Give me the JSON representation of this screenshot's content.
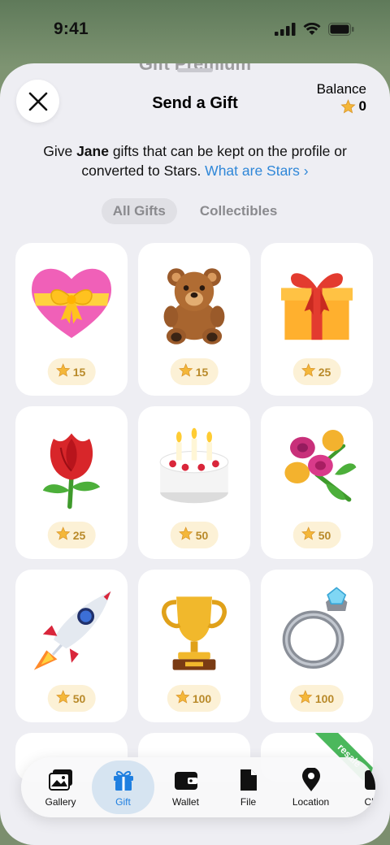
{
  "status": {
    "time": "9:41"
  },
  "sheet": {
    "behind_title": "Gift Premium",
    "title": "Send a Gift",
    "balance_label": "Balance",
    "balance_value": "0"
  },
  "description": {
    "part1": "Give ",
    "name": "Jane",
    "part2": " gifts that can be kept on the profile or converted to Stars. ",
    "link": "What are Stars ›"
  },
  "tabs": [
    {
      "label": "All Gifts",
      "active": true
    },
    {
      "label": "Collectibles",
      "active": false
    }
  ],
  "gifts": [
    {
      "name": "heart-gift",
      "price": "15"
    },
    {
      "name": "teddy-bear-gift",
      "price": "15"
    },
    {
      "name": "present-box-gift",
      "price": "25"
    },
    {
      "name": "rose-gift",
      "price": "25"
    },
    {
      "name": "birthday-cake-gift",
      "price": "50"
    },
    {
      "name": "bouquet-gift",
      "price": "50"
    },
    {
      "name": "rocket-gift",
      "price": "50"
    },
    {
      "name": "trophy-gift",
      "price": "100"
    },
    {
      "name": "diamond-ring-gift",
      "price": "100"
    }
  ],
  "resale_badge": "resale",
  "nav": [
    {
      "label": "Gallery",
      "icon": "gallery-icon"
    },
    {
      "label": "Gift",
      "icon": "gift-icon",
      "active": true
    },
    {
      "label": "Wallet",
      "icon": "wallet-icon"
    },
    {
      "label": "File",
      "icon": "file-icon"
    },
    {
      "label": "Location",
      "icon": "location-icon"
    },
    {
      "label": "Che",
      "icon": "checklist-icon"
    }
  ],
  "colors": {
    "accent": "#2f87d8",
    "star": "#f4b73a",
    "price_bg": "#fcf1d6",
    "resale": "#4bb85c"
  }
}
